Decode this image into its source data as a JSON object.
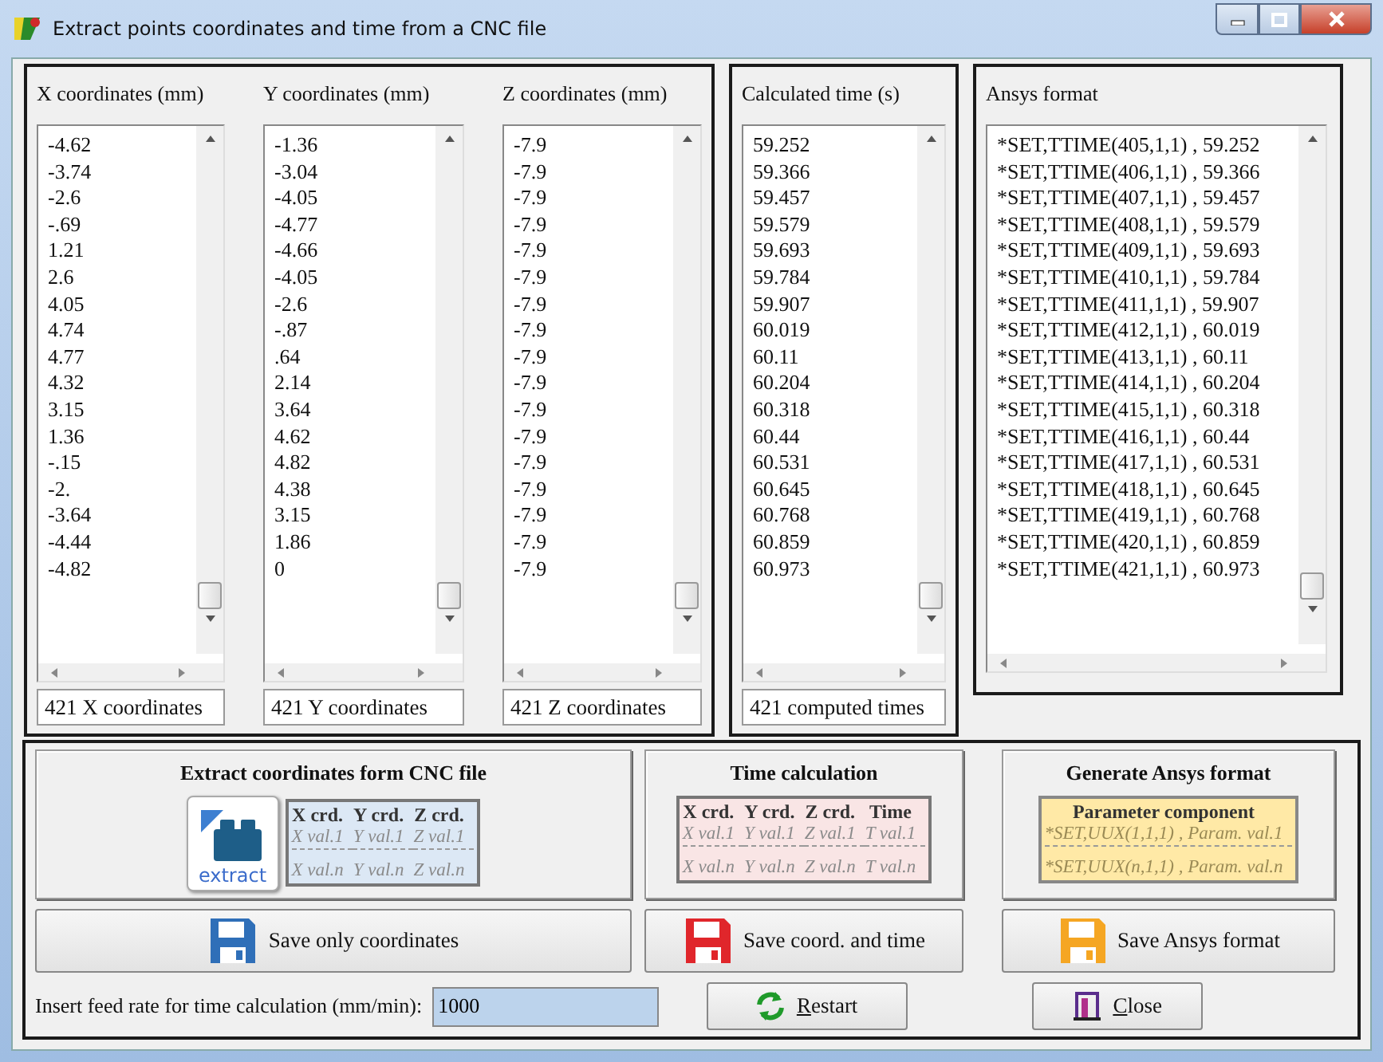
{
  "window": {
    "title": "Extract points coordinates and time from a CNC file"
  },
  "coordinates": [
    {
      "label": "X coordinates (mm)",
      "values": [
        "-4.62",
        "-3.74",
        "-2.6",
        "-.69",
        "1.21",
        "2.6",
        "4.05",
        "4.74",
        "4.77",
        "4.32",
        "3.15",
        "1.36",
        "-.15",
        "-2.",
        "-3.64",
        "-4.44",
        "-4.82"
      ],
      "count": "421 X coordinates"
    },
    {
      "label": "Y coordinates (mm)",
      "values": [
        "-1.36",
        "-3.04",
        "-4.05",
        "-4.77",
        "-4.66",
        "-4.05",
        "-2.6",
        "-.87",
        ".64",
        "2.14",
        "3.64",
        "4.62",
        "4.82",
        "4.38",
        "3.15",
        "1.86",
        "0"
      ],
      "count": "421 Y coordinates"
    },
    {
      "label": "Z coordinates (mm)",
      "values": [
        "-7.9",
        "-7.9",
        "-7.9",
        "-7.9",
        "-7.9",
        "-7.9",
        "-7.9",
        "-7.9",
        "-7.9",
        "-7.9",
        "-7.9",
        "-7.9",
        "-7.9",
        "-7.9",
        "-7.9",
        "-7.9",
        "-7.9"
      ],
      "count": "421 Z coordinates"
    }
  ],
  "time": {
    "label": "Calculated time (s)",
    "values": [
      "59.252",
      "59.366",
      "59.457",
      "59.579",
      "59.693",
      "59.784",
      "59.907",
      "60.019",
      "60.11",
      "60.204",
      "60.318",
      "60.44",
      "60.531",
      "60.645",
      "60.768",
      "60.859",
      "60.973"
    ],
    "count": "421 computed times"
  },
  "ansys": {
    "label": "Ansys format",
    "values": [
      "*SET,TTIME(405,1,1) , 59.252",
      "*SET,TTIME(406,1,1) , 59.366",
      "*SET,TTIME(407,1,1) , 59.457",
      "*SET,TTIME(408,1,1) , 59.579",
      "*SET,TTIME(409,1,1) , 59.693",
      "*SET,TTIME(410,1,1) , 59.784",
      "*SET,TTIME(411,1,1) , 59.907",
      "*SET,TTIME(412,1,1) , 60.019",
      "*SET,TTIME(413,1,1) , 60.11",
      "*SET,TTIME(414,1,1) , 60.204",
      "*SET,TTIME(415,1,1) , 60.318",
      "*SET,TTIME(416,1,1) , 60.44",
      "*SET,TTIME(417,1,1) , 60.531",
      "*SET,TTIME(418,1,1) , 60.645",
      "*SET,TTIME(419,1,1) , 60.768",
      "*SET,TTIME(420,1,1) , 60.859",
      "*SET,TTIME(421,1,1) , 60.973"
    ]
  },
  "panels": [
    {
      "kind": "extract",
      "title": "Extract coordinates form CNC file",
      "icon_label": "extract",
      "headers": [
        "X crd.",
        "Y crd.",
        "Z crd."
      ],
      "first": [
        "X val.1",
        "Y val.1",
        "Z val.1"
      ],
      "last": [
        "X val.n",
        "Y val.n",
        "Z val.n"
      ]
    },
    {
      "kind": "time",
      "title": "Time calculation",
      "headers": [
        "X crd.",
        "Y crd.",
        "Z crd.",
        "Time"
      ],
      "first": [
        "X val.1",
        "Y val.1",
        "Z val.1",
        "T val.1"
      ],
      "last": [
        "X val.n",
        "Y val.n",
        "Z val.n",
        "T val.n"
      ]
    },
    {
      "kind": "ansys",
      "title": "Generate Ansys format",
      "headers": [
        "Parameter component"
      ],
      "first": [
        "*SET,UUX(1,1,1) , Param. val.1"
      ],
      "last": [
        "*SET,UUX(n,1,1) , Param. val.n"
      ]
    }
  ],
  "save_buttons": [
    {
      "label": "Save only coordinates",
      "color": "#2f6fb8"
    },
    {
      "label": "Save coord. and time",
      "color": "#e0262b"
    },
    {
      "label": "Save Ansys format",
      "color": "#f5a623"
    }
  ],
  "feed_rate": {
    "label": "Insert feed rate for time calculation (mm/min):",
    "value": "1000"
  },
  "actions": [
    {
      "kind": "restart",
      "label": "Restart"
    },
    {
      "kind": "close",
      "label": "Close"
    }
  ]
}
